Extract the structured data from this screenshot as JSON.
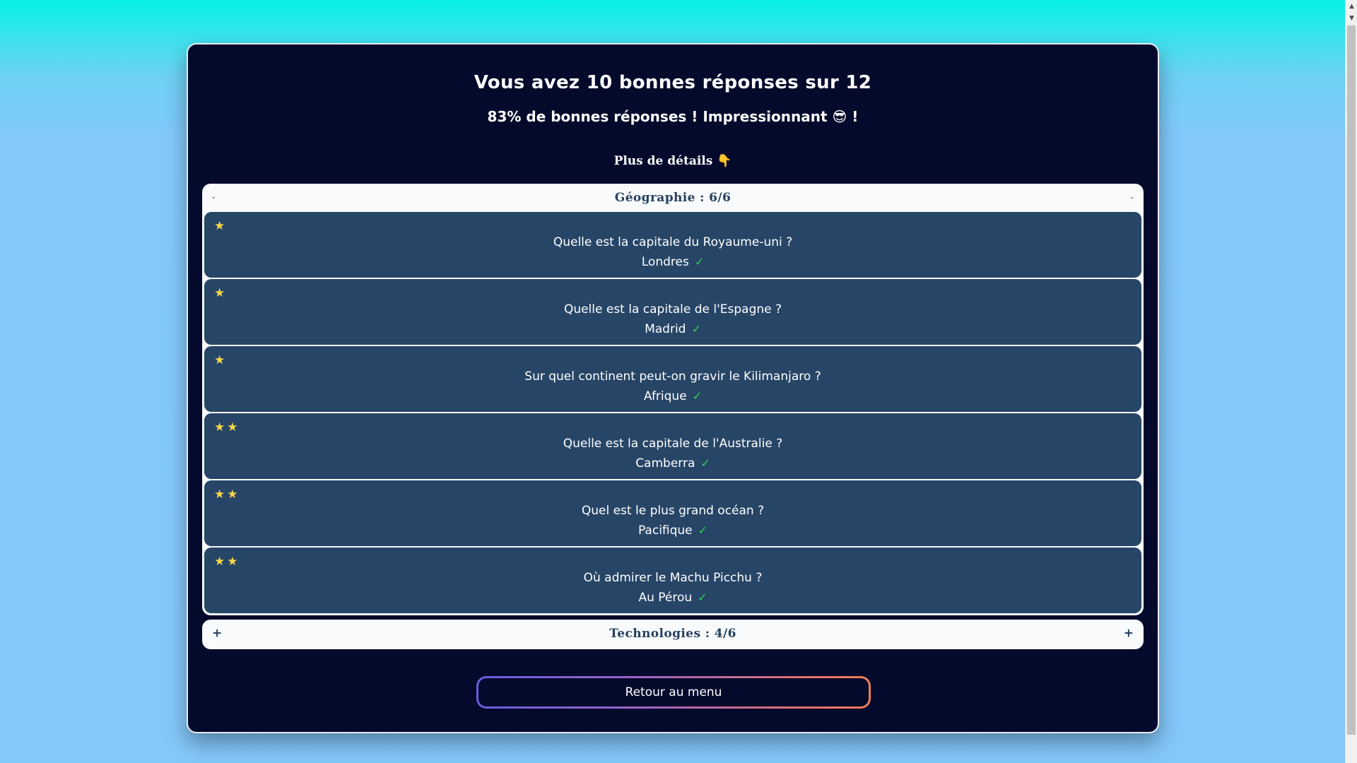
{
  "results": {
    "title": "Vous avez 10 bonnes réponses sur 12",
    "subtitle": "83% de bonnes réponses ! Impressionnant 😎 !",
    "details_label": "Plus de détails",
    "details_icon": "👇"
  },
  "categories": [
    {
      "title": "Géographie : 6/6",
      "toggle": "-",
      "expanded": true,
      "questions": [
        {
          "stars": "★",
          "question": "Quelle est la capitale du Royaume-uni ?",
          "answer": "Londres",
          "correct": true
        },
        {
          "stars": "★",
          "question": "Quelle est la capitale de l'Espagne ?",
          "answer": "Madrid",
          "correct": true
        },
        {
          "stars": "★",
          "question": "Sur quel continent peut-on gravir le Kilimanjaro ?",
          "answer": "Afrique",
          "correct": true
        },
        {
          "stars": "★★",
          "question": "Quelle est la capitale de l'Australie ?",
          "answer": "Camberra",
          "correct": true
        },
        {
          "stars": "★★",
          "question": "Quel est le plus grand océan ?",
          "answer": "Pacifique",
          "correct": true
        },
        {
          "stars": "★★",
          "question": "Où admirer le Machu Picchu ?",
          "answer": "Au Pérou",
          "correct": true
        }
      ]
    },
    {
      "title": "Technologies : 4/6",
      "toggle": "+",
      "expanded": false
    }
  ],
  "check_icon": "✓",
  "menu_button": "Retour au menu",
  "colors": {
    "card_bg": "#030a2b",
    "question_bg": "#274566",
    "star": "#f6d64a",
    "check": "#2fd158"
  }
}
